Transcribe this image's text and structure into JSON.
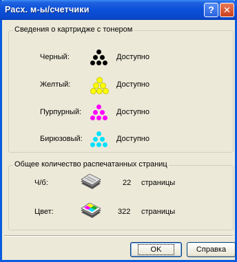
{
  "window": {
    "title": "Расх. м-ы/счетчики"
  },
  "titlebar_buttons": {
    "help": "?",
    "close": "✕"
  },
  "cartridge_group": {
    "title": "Сведения о картридже с тонером",
    "items": [
      {
        "label": "Черный:",
        "status": "Доступно",
        "color": "#000000"
      },
      {
        "label": "Желтый:",
        "status": "Доступно",
        "color": "#ffff00"
      },
      {
        "label": "Пурпурный:",
        "status": "Доступно",
        "color": "#ff00ff"
      },
      {
        "label": "Бирюзовый:",
        "status": "Доступно",
        "color": "#00ffff"
      }
    ]
  },
  "pages_group": {
    "title": "Общее количество распечатанных страниц",
    "items": [
      {
        "label": "Ч/б:",
        "count": "22",
        "unit": "страницы",
        "icon": "bw-pages-icon"
      },
      {
        "label": "Цвет:",
        "count": "322",
        "unit": "страницы",
        "icon": "color-pages-icon"
      }
    ]
  },
  "buttons": {
    "ok": "OK",
    "help": "Справка"
  }
}
